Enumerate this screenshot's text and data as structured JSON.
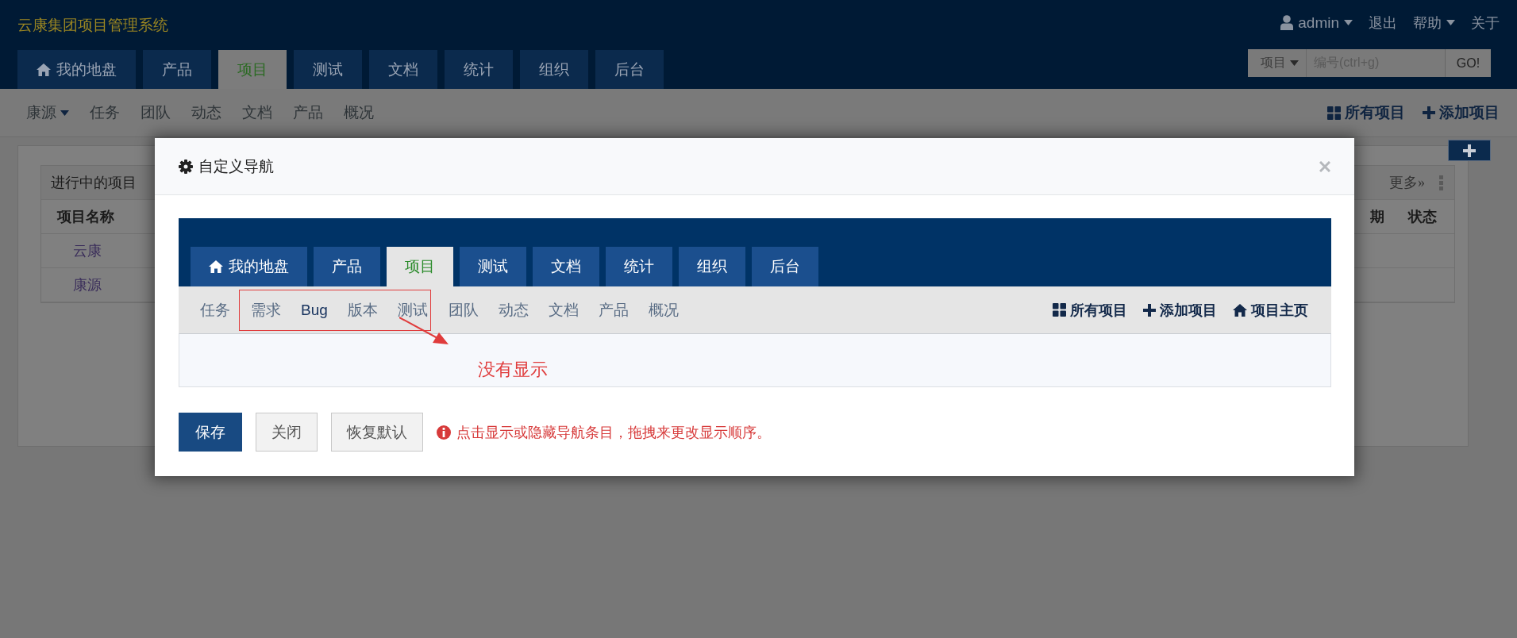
{
  "header": {
    "title": "云康集团项目管理系统",
    "user": "admin",
    "links": [
      {
        "label": "退出",
        "dropdown": false
      },
      {
        "label": "帮助",
        "dropdown": true
      },
      {
        "label": "关于",
        "dropdown": false
      }
    ],
    "search": {
      "scope": "项目",
      "placeholder": "编号(ctrl+g)",
      "button": "GO!"
    },
    "tabs": [
      {
        "label": "我的地盘",
        "kind": "home",
        "selected": false
      },
      {
        "label": "产品",
        "kind": "plain",
        "selected": false
      },
      {
        "label": "项目",
        "kind": "plain",
        "selected": true
      },
      {
        "label": "测试",
        "kind": "plain",
        "selected": false
      },
      {
        "label": "文档",
        "kind": "plain",
        "selected": false
      },
      {
        "label": "统计",
        "kind": "plain",
        "selected": false
      },
      {
        "label": "组织",
        "kind": "plain",
        "selected": false
      },
      {
        "label": "后台",
        "kind": "plain",
        "selected": false
      }
    ]
  },
  "subnav": {
    "switcher": "康源",
    "items": [
      "任务",
      "团队",
      "动态",
      "文档",
      "产品",
      "概况"
    ],
    "actions": [
      {
        "label": "所有项目",
        "kind": "grid"
      },
      {
        "label": "添加项目",
        "kind": "add"
      }
    ]
  },
  "panel": {
    "title": "进行中的项目",
    "more": "更多»",
    "columns": [
      "项目名称",
      "期",
      "状态"
    ],
    "rows": [
      {
        "name": "云康"
      },
      {
        "name": "康源"
      }
    ]
  },
  "dialog": {
    "title": "自定义导航",
    "preview": {
      "tabs": [
        {
          "label": "我的地盘",
          "kind": "home",
          "selected": false
        },
        {
          "label": "产品",
          "kind": "plain",
          "selected": false
        },
        {
          "label": "项目",
          "kind": "plain",
          "selected": true
        },
        {
          "label": "测试",
          "kind": "plain",
          "selected": false
        },
        {
          "label": "文档",
          "kind": "plain",
          "selected": false
        },
        {
          "label": "统计",
          "kind": "plain",
          "selected": false
        },
        {
          "label": "组织",
          "kind": "plain",
          "selected": false
        },
        {
          "label": "后台",
          "kind": "plain",
          "selected": false
        }
      ],
      "items": [
        {
          "label": "任务",
          "flagged": false
        },
        {
          "label": "需求",
          "flagged": true
        },
        {
          "label": "Bug",
          "flagged": true
        },
        {
          "label": "版本",
          "flagged": true
        },
        {
          "label": "测试",
          "flagged": true
        },
        {
          "label": "团队",
          "flagged": false
        },
        {
          "label": "动态",
          "flagged": false
        },
        {
          "label": "文档",
          "flagged": false
        },
        {
          "label": "产品",
          "flagged": false
        },
        {
          "label": "概况",
          "flagged": false
        }
      ],
      "actions": [
        {
          "label": "所有项目",
          "kind": "grid"
        },
        {
          "label": "添加项目",
          "kind": "add"
        },
        {
          "label": "项目主页",
          "kind": "home"
        }
      ]
    },
    "annotation": "没有显示",
    "buttons": [
      {
        "label": "保存",
        "kind": "primary"
      },
      {
        "label": "关闭",
        "kind": "default"
      },
      {
        "label": "恢复默认",
        "kind": "default"
      }
    ],
    "hint": "点击显示或隐藏导航条目，拖拽来更改显示顺序。"
  }
}
